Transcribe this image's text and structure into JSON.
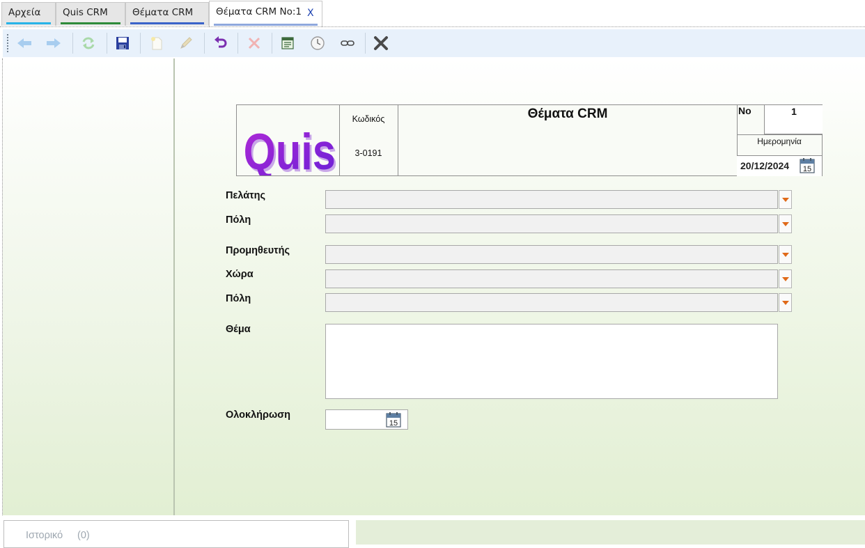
{
  "tabs": [
    {
      "label": "Αρχεία",
      "underline": "#27b3e8"
    },
    {
      "label": "Quis CRM",
      "underline": "#2e8b3a"
    },
    {
      "label": "Θέματα CRM",
      "underline": "#3a63c9"
    },
    {
      "label": "Θέματα CRM No:1",
      "underline": "#8fa8dd",
      "active": true
    }
  ],
  "tab_close_label": "X",
  "toolbar": {
    "buttons": [
      "back-icon",
      "forward-icon",
      "refresh-icon",
      "save-icon",
      "new-document-icon",
      "edit-icon",
      "undo-icon",
      "delete-icon",
      "report-icon",
      "clock-icon",
      "link-icon",
      "close-icon"
    ]
  },
  "header": {
    "logo_text": "Quis",
    "code_label": "Κωδικός",
    "code_value": "3-0191",
    "title": "Θέματα CRM",
    "no_label": "No",
    "no_value": "1",
    "date_label": "Ημερομηνία",
    "date_value": "20/12/2024",
    "calendar_day": "15"
  },
  "form": {
    "customer_label": "Πελάτης",
    "customer_city_label": "Πόλη",
    "supplier_label": "Προμηθευτής",
    "country_label": "Χώρα",
    "supplier_city_label": "Πόλη",
    "subject_label": "Θέμα",
    "completion_label": "Ολοκλήρωση",
    "completion_calendar_day": "15"
  },
  "history": {
    "label": "Ιστορικό",
    "count": "(0)"
  },
  "colors": {
    "accent_orange": "#e06a1a",
    "logo_purple": "#8b1fd6",
    "panel_green": "#e2efd3"
  }
}
